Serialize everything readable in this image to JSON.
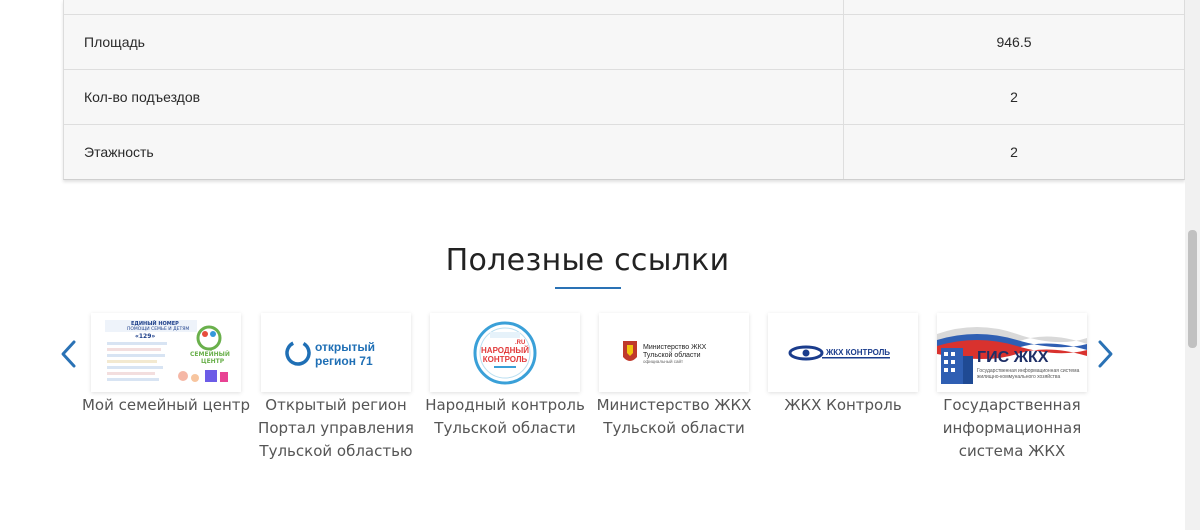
{
  "table": {
    "rows": [
      {
        "label": "",
        "value": ""
      },
      {
        "label": "Площадь",
        "value": "946.5"
      },
      {
        "label": "Кол-во подъездов",
        "value": "2"
      },
      {
        "label": "Этажность",
        "value": "2"
      }
    ]
  },
  "links_section": {
    "title": "Полезные ссылки",
    "items": [
      {
        "caption": "Мой семейный центр",
        "logo_lines": [
          "ЕДИНЫЙ НОМЕР",
          "ПОМОЩИ СЕМЬЕ И ДЕТЯМ",
          "«129»",
          "СЕМЕЙНЫЙ",
          "ЦЕНТР"
        ]
      },
      {
        "caption": "Открытый регион Портал управления Тульской областью",
        "logo_lines": [
          "открытый",
          "регион 71"
        ]
      },
      {
        "caption": "Народный контроль Тульской области",
        "logo_lines": [
          "НАРОДНЫЙ",
          "КОНТРОЛЬ",
          ".RU"
        ]
      },
      {
        "caption": "Министерство ЖКХ Тульской области",
        "logo_lines": [
          "Министерство ЖКХ",
          "Тульской области",
          "официальный сайт"
        ]
      },
      {
        "caption": "ЖКХ Контроль",
        "logo_lines": [
          "ЖКХ КОНТРОЛЬ"
        ]
      },
      {
        "caption": "Государственная информационная система ЖКХ",
        "logo_lines": [
          "ГИС ЖКХ",
          "Государственная информационная система",
          "жилищно-коммунального хозяйства"
        ]
      }
    ]
  },
  "colors": {
    "accent": "#2a72b5",
    "arrow": "#2a72b5"
  },
  "icons": {
    "prev": "chevron-left-icon",
    "next": "chevron-right-icon"
  }
}
